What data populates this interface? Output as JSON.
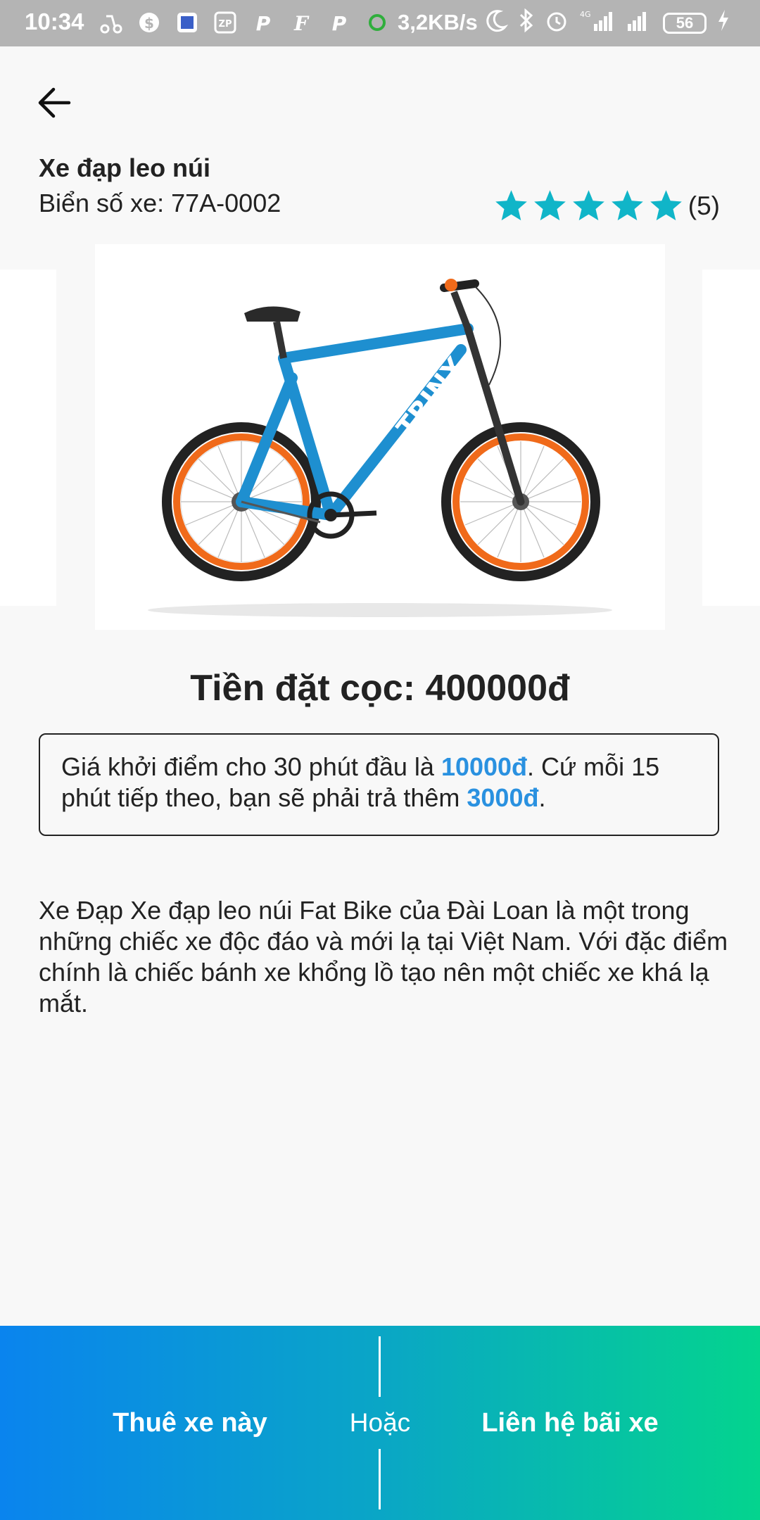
{
  "status_bar": {
    "time": "10:34",
    "net_speed": "3,2KB/s",
    "network": "4G",
    "battery": "56"
  },
  "product": {
    "name": "Xe đạp leo núi",
    "plate": "Biển số xe: 77A-0002",
    "rating_stars": 5,
    "rating_count": "(5)",
    "image_brand_text": "TRINX"
  },
  "deposit": {
    "text": "Tiền đặt cọc: 400000đ"
  },
  "pricing": {
    "part1": "Giá khởi điểm cho 30 phút đầu là ",
    "price1": "10000đ",
    "part2": ". Cứ mỗi 15 phút tiếp theo, bạn sẽ phải trả thêm ",
    "price2": "3000đ",
    "part3": "."
  },
  "description": "Xe Đạp Xe đạp leo núi Fat Bike của Đài Loan là một trong những chiếc xe độc đáo và mới lạ tại Việt Nam. Với đặc điểm chính là chiếc bánh xe khổng lồ tạo nên một chiếc xe khá lạ mắt.",
  "actions": {
    "rent_label": "Thuê xe này",
    "or_label": "Hoặc",
    "contact_label": "Liên hệ bãi xe"
  },
  "colors": {
    "accent": "#2a91e0",
    "star": "#10b5c8",
    "gradient_start": "#0a84ee",
    "gradient_end": "#04d48e"
  }
}
